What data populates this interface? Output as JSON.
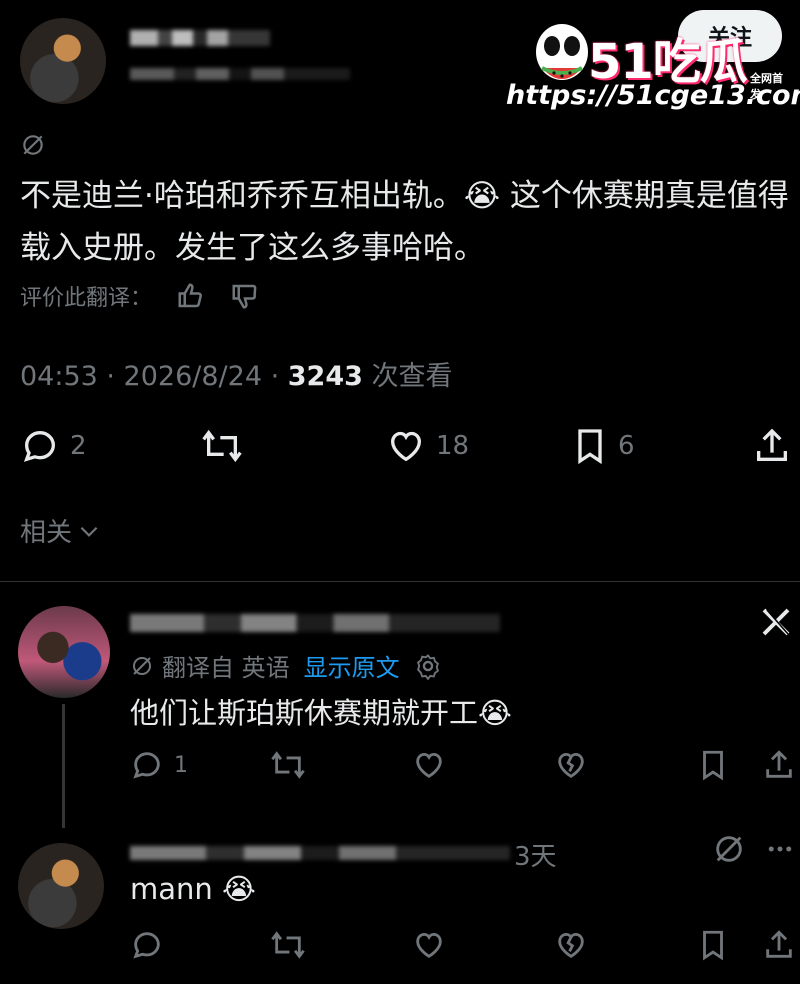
{
  "watermark": {
    "brand": "51吃瓜",
    "tagline": "全网首发",
    "url": "https://51cge13.com"
  },
  "header": {
    "follow_label": "关注"
  },
  "tweet": {
    "text": "不是迪兰·哈珀和乔乔互相出轨。😭 这个休赛期真是值得载入史册。发生了这么多事哈哈。",
    "rate_label": "评价此翻译：",
    "time": "04:53 · 2026/8/24 · ",
    "views_count": "3243",
    "views_label": " 次查看",
    "stats": {
      "replies": "2",
      "likes": "18",
      "bookmarks": "6"
    }
  },
  "related": {
    "label": "相关"
  },
  "reply1": {
    "translated_from": "翻译自 英语",
    "show_original": "显示原文",
    "text": "他们让斯珀斯休赛期就开工😭",
    "replies": "1"
  },
  "reply2": {
    "time_suffix": "3天",
    "text": "mann 😭"
  },
  "colors": {
    "accent": "#1d9bf0",
    "muted": "#71767b",
    "text": "#e7e9ea",
    "bg": "#000000",
    "watermark_pink": "#ff2a6d"
  },
  "icons": [
    "translate-off-icon",
    "thumbs-up-icon",
    "thumbs-down-icon",
    "reply-icon",
    "retweet-icon",
    "like-icon",
    "bookmark-icon",
    "share-icon",
    "chevron-down-icon",
    "settings-icon",
    "close-x-icon",
    "more-icon",
    "broken-heart-icon"
  ]
}
